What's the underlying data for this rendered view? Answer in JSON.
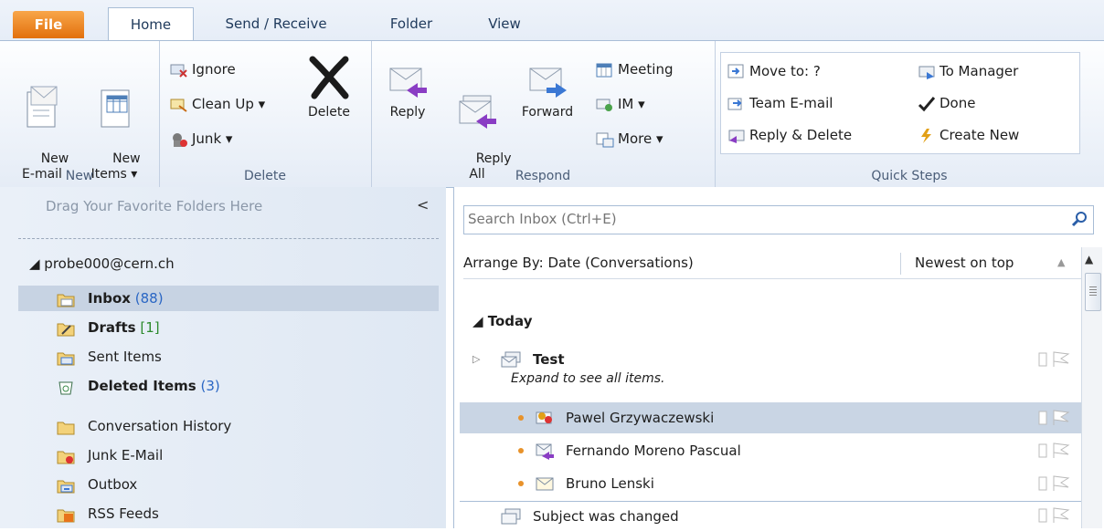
{
  "tabs": {
    "file": "File",
    "home": "Home",
    "send": "Send / Receive",
    "folder": "Folder",
    "view": "View"
  },
  "ribbon": {
    "new": {
      "label": "New",
      "email": "New\nE-mail",
      "items": "New\nItems ▾"
    },
    "delete": {
      "label": "Delete",
      "ignore": "Ignore",
      "cleanup": "Clean Up ▾",
      "junk": "Junk ▾",
      "delete_btn": "Delete"
    },
    "respond": {
      "label": "Respond",
      "reply": "Reply",
      "reply_all": "Reply\nAll",
      "forward": "Forward",
      "meeting": "Meeting",
      "im": "IM ▾",
      "more": "More ▾"
    },
    "quick": {
      "label": "Quick Steps",
      "move": "Move to: ?",
      "team": "Team E-mail",
      "reply_delete": "Reply & Delete",
      "to_manager": "To Manager",
      "done": "Done",
      "create_new": "Create New"
    }
  },
  "nav": {
    "drag_text": "Drag Your Favorite Folders Here",
    "collapse": "<",
    "account": "◢ probe000@cern.ch",
    "folders": [
      {
        "label": "Inbox",
        "count": "(88)"
      },
      {
        "label": "Drafts",
        "count": "[1]"
      },
      {
        "label": "Sent Items",
        "count": ""
      },
      {
        "label": "Deleted Items",
        "count": "(3)"
      },
      {
        "label": "Conversation History",
        "count": ""
      },
      {
        "label": "Junk E-Mail",
        "count": ""
      },
      {
        "label": "Outbox",
        "count": ""
      },
      {
        "label": "RSS Feeds",
        "count": ""
      }
    ]
  },
  "list": {
    "search_placeholder": "Search Inbox (Ctrl+E)",
    "arrange": "Arrange By: Date (Conversations)",
    "newest": "Newest on top",
    "group": "◢  Today",
    "conversation": {
      "subject": "Test",
      "hint": "Expand to see all items."
    },
    "senders": [
      "Pawel Grzywaczewski",
      "Fernando Moreno Pascual",
      "Bruno Lenski"
    ],
    "next_subject": "Subject was changed"
  }
}
